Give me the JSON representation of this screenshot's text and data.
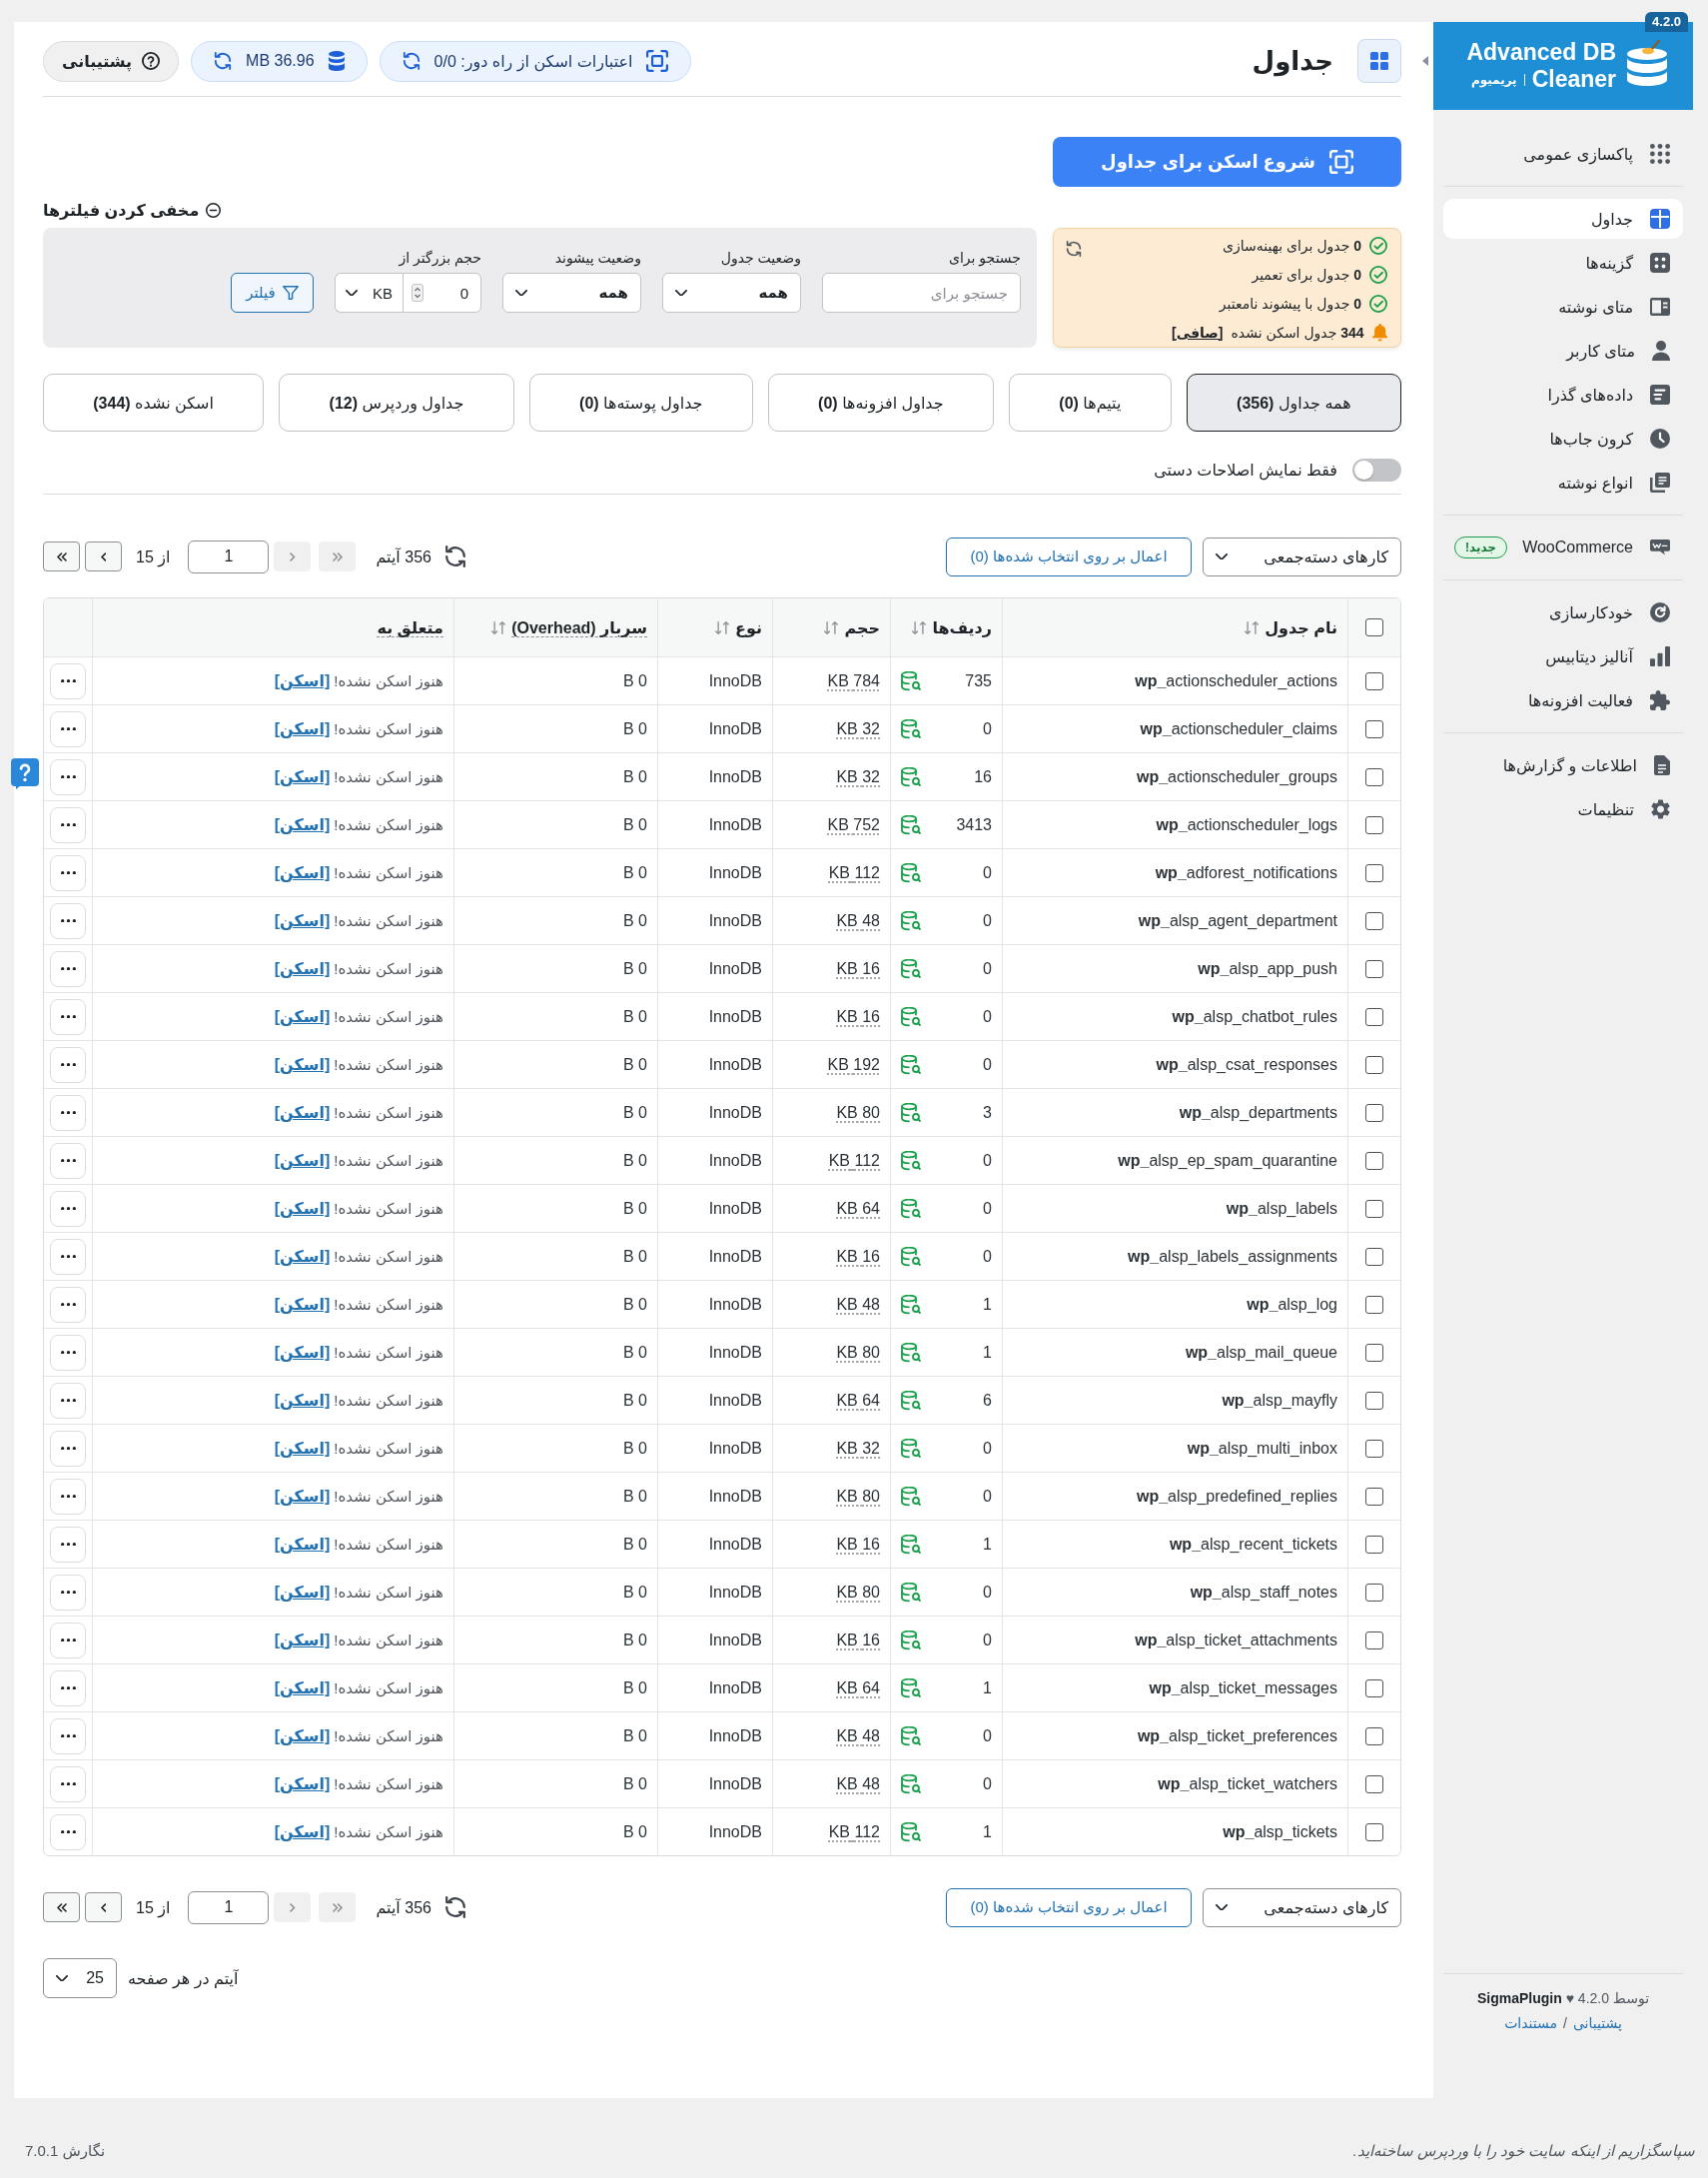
{
  "sidebar": {
    "logo": {
      "title_lines": [
        "Advanced DB",
        "Cleaner"
      ],
      "edition": "پریمیوم",
      "version": "4.2.0"
    },
    "sections": [
      {
        "items": [
          {
            "label": "پاکسازی عمومی",
            "selected": false
          }
        ]
      },
      {
        "items": [
          {
            "label": "جداول",
            "selected": true
          },
          {
            "label": "گزینه‌ها",
            "selected": false
          },
          {
            "label": "متای نوشته",
            "selected": false
          },
          {
            "label": "متای کاربر",
            "selected": false
          },
          {
            "label": "داده‌های گذرا",
            "selected": false
          },
          {
            "label": "کرون جاب‌ها",
            "selected": false
          },
          {
            "label": "انواع نوشته",
            "selected": false
          }
        ]
      },
      {
        "items": [
          {
            "label": "WooCommerce",
            "badge": "جدید!",
            "selected": false
          }
        ]
      },
      {
        "items": [
          {
            "label": "خودکارسازی",
            "selected": false
          },
          {
            "label": "آنالیز دیتابیس",
            "selected": false
          },
          {
            "label": "فعالیت افزونه‌ها",
            "selected": false
          }
        ]
      },
      {
        "items": [
          {
            "label": "اطلاعات و گزارش‌ها",
            "selected": false
          },
          {
            "label": "تنظیمات",
            "selected": false
          }
        ]
      }
    ],
    "footer": {
      "credit": "توسط **SigmaPlugin** ♥ 4.2.0",
      "links": [
        "پشتیبانی",
        "مستندات"
      ],
      "separator": "/"
    }
  },
  "header": {
    "title": "جداول",
    "remote_scan": {
      "label": "اعتبارات اسکن از راه دور:",
      "value": "0/0"
    },
    "db_size": "36.96 MB",
    "support": "پشتیبانی"
  },
  "scan_button": "شروع اسکن برای جداول",
  "filters": {
    "toggle": "مخفی کردن فیلترها",
    "summary": [
      {
        "kind": "ok",
        "count": "0",
        "text": "جدول برای بهینه‌سازی"
      },
      {
        "kind": "ok",
        "count": "0",
        "text": "جدول برای تعمیر"
      },
      {
        "kind": "ok",
        "count": "0",
        "text": "جدول با پیشوند نامعتبر"
      },
      {
        "kind": "warning",
        "count": "344",
        "text": "جدول اسکن نشده",
        "link": "[صافی]"
      }
    ],
    "fields": [
      {
        "kind": "search",
        "label": "جستجو برای",
        "placeholder": "جستجو برای"
      },
      {
        "kind": "select",
        "label": "وضعیت جدول",
        "value": "همه"
      },
      {
        "kind": "select",
        "label": "وضعیت پیشوند",
        "value": "همه"
      },
      {
        "kind": "size",
        "label": "حجم بزرگتر از",
        "value": "0",
        "unit": "KB"
      }
    ],
    "button": "فیلتر"
  },
  "tabs": [
    {
      "label": "همه جداول",
      "count": "(356)",
      "selected": true
    },
    {
      "label": "یتیم‌ها",
      "count": "(0)",
      "selected": false
    },
    {
      "label": "جداول افزونه‌ها",
      "count": "(0)",
      "selected": false
    },
    {
      "label": "جداول پوسته‌ها",
      "count": "(0)",
      "selected": false
    },
    {
      "label": "جداول وردپرس",
      "count": "(12)",
      "selected": false
    },
    {
      "label": "اسکن نشده",
      "count": "(344)",
      "selected": false
    }
  ],
  "manual_toggle": {
    "label": "فقط نمایش اصلاحات دستی",
    "on": false
  },
  "top_toolbar": {
    "bulk_select": "کارهای دسته‌جمعی",
    "apply": "اعمال بر روی انتخاب شده‌ها (0)",
    "count": "356 آیتم",
    "pager": {
      "first": {
        "disabled": true
      },
      "prev": {
        "disabled": true
      },
      "page": "1",
      "total": "از 15",
      "next": {
        "disabled": false
      },
      "last": {
        "disabled": false
      }
    }
  },
  "table": {
    "select_all": {
      "checked": false
    },
    "columns": [
      {
        "label": "نام جدول",
        "sortable": true,
        "hint": false
      },
      {
        "label": "ردیف‌ها",
        "sortable": true,
        "hint": false
      },
      {
        "label": "حجم",
        "sortable": true,
        "hint": false
      },
      {
        "label": "نوع",
        "sortable": true,
        "hint": false
      },
      {
        "label": "سربار (Overhead)",
        "sortable": true,
        "hint": true
      },
      {
        "label": "متعلق به",
        "sortable": false,
        "hint": true
      }
    ],
    "rows": [
      {
        "checked": false,
        "name": "**wp_**actionscheduler_actions",
        "rows": "735",
        "size": "784 KB",
        "type": "InnoDB",
        "overhead": "0 B",
        "status": "هنوز اسکن نشده!",
        "action": "[اسکن]"
      },
      {
        "checked": false,
        "name": "**wp_**actionscheduler_claims",
        "rows": "0",
        "size": "32 KB",
        "type": "InnoDB",
        "overhead": "0 B",
        "status": "هنوز اسکن نشده!",
        "action": "[اسکن]"
      },
      {
        "checked": false,
        "name": "**wp_**actionscheduler_groups",
        "rows": "16",
        "size": "32 KB",
        "type": "InnoDB",
        "overhead": "0 B",
        "status": "هنوز اسکن نشده!",
        "action": "[اسکن]"
      },
      {
        "checked": false,
        "name": "**wp_**actionscheduler_logs",
        "rows": "3413",
        "size": "752 KB",
        "type": "InnoDB",
        "overhead": "0 B",
        "status": "هنوز اسکن نشده!",
        "action": "[اسکن]"
      },
      {
        "checked": false,
        "name": "**wp_**adforest_notifications",
        "rows": "0",
        "size": "112 KB",
        "type": "InnoDB",
        "overhead": "0 B",
        "status": "هنوز اسکن نشده!",
        "action": "[اسکن]"
      },
      {
        "checked": false,
        "name": "**wp_**alsp_agent_department",
        "rows": "0",
        "size": "48 KB",
        "type": "InnoDB",
        "overhead": "0 B",
        "status": "هنوز اسکن نشده!",
        "action": "[اسکن]"
      },
      {
        "checked": false,
        "name": "**wp_**alsp_app_push",
        "rows": "0",
        "size": "16 KB",
        "type": "InnoDB",
        "overhead": "0 B",
        "status": "هنوز اسکن نشده!",
        "action": "[اسکن]"
      },
      {
        "checked": false,
        "name": "**wp_**alsp_chatbot_rules",
        "rows": "0",
        "size": "16 KB",
        "type": "InnoDB",
        "overhead": "0 B",
        "status": "هنوز اسکن نشده!",
        "action": "[اسکن]"
      },
      {
        "checked": false,
        "name": "**wp_**alsp_csat_responses",
        "rows": "0",
        "size": "192 KB",
        "type": "InnoDB",
        "overhead": "0 B",
        "status": "هنوز اسکن نشده!",
        "action": "[اسکن]"
      },
      {
        "checked": false,
        "name": "**wp_**alsp_departments",
        "rows": "3",
        "size": "80 KB",
        "type": "InnoDB",
        "overhead": "0 B",
        "status": "هنوز اسکن نشده!",
        "action": "[اسکن]"
      },
      {
        "checked": false,
        "name": "**wp_**alsp_ep_spam_quarantine",
        "rows": "0",
        "size": "112 KB",
        "type": "InnoDB",
        "overhead": "0 B",
        "status": "هنوز اسکن نشده!",
        "action": "[اسکن]"
      },
      {
        "checked": false,
        "name": "**wp_**alsp_labels",
        "rows": "0",
        "size": "64 KB",
        "type": "InnoDB",
        "overhead": "0 B",
        "status": "هنوز اسکن نشده!",
        "action": "[اسکن]"
      },
      {
        "checked": false,
        "name": "**wp_**alsp_labels_assignments",
        "rows": "0",
        "size": "16 KB",
        "type": "InnoDB",
        "overhead": "0 B",
        "status": "هنوز اسکن نشده!",
        "action": "[اسکن]"
      },
      {
        "checked": false,
        "name": "**wp_**alsp_log",
        "rows": "1",
        "size": "48 KB",
        "type": "InnoDB",
        "overhead": "0 B",
        "status": "هنوز اسکن نشده!",
        "action": "[اسکن]"
      },
      {
        "checked": false,
        "name": "**wp_**alsp_mail_queue",
        "rows": "1",
        "size": "80 KB",
        "type": "InnoDB",
        "overhead": "0 B",
        "status": "هنوز اسکن نشده!",
        "action": "[اسکن]"
      },
      {
        "checked": false,
        "name": "**wp_**alsp_mayfly",
        "rows": "6",
        "size": "64 KB",
        "type": "InnoDB",
        "overhead": "0 B",
        "status": "هنوز اسکن نشده!",
        "action": "[اسکن]"
      },
      {
        "checked": false,
        "name": "**wp_**alsp_multi_inbox",
        "rows": "0",
        "size": "32 KB",
        "type": "InnoDB",
        "overhead": "0 B",
        "status": "هنوز اسکن نشده!",
        "action": "[اسکن]"
      },
      {
        "checked": false,
        "name": "**wp_**alsp_predefined_replies",
        "rows": "0",
        "size": "80 KB",
        "type": "InnoDB",
        "overhead": "0 B",
        "status": "هنوز اسکن نشده!",
        "action": "[اسکن]"
      },
      {
        "checked": false,
        "name": "**wp_**alsp_recent_tickets",
        "rows": "1",
        "size": "16 KB",
        "type": "InnoDB",
        "overhead": "0 B",
        "status": "هنوز اسکن نشده!",
        "action": "[اسکن]"
      },
      {
        "checked": false,
        "name": "**wp_**alsp_staff_notes",
        "rows": "0",
        "size": "80 KB",
        "type": "InnoDB",
        "overhead": "0 B",
        "status": "هنوز اسکن نشده!",
        "action": "[اسکن]"
      },
      {
        "checked": false,
        "name": "**wp_**alsp_ticket_attachments",
        "rows": "0",
        "size": "16 KB",
        "type": "InnoDB",
        "overhead": "0 B",
        "status": "هنوز اسکن نشده!",
        "action": "[اسکن]"
      },
      {
        "checked": false,
        "name": "**wp_**alsp_ticket_messages",
        "rows": "1",
        "size": "64 KB",
        "type": "InnoDB",
        "overhead": "0 B",
        "status": "هنوز اسکن نشده!",
        "action": "[اسکن]"
      },
      {
        "checked": false,
        "name": "**wp_**alsp_ticket_preferences",
        "rows": "0",
        "size": "48 KB",
        "type": "InnoDB",
        "overhead": "0 B",
        "status": "هنوز اسکن نشده!",
        "action": "[اسکن]"
      },
      {
        "checked": false,
        "name": "**wp_**alsp_ticket_watchers",
        "rows": "0",
        "size": "48 KB",
        "type": "InnoDB",
        "overhead": "0 B",
        "status": "هنوز اسکن نشده!",
        "action": "[اسکن]"
      },
      {
        "checked": false,
        "name": "**wp_**alsp_tickets",
        "rows": "1",
        "size": "112 KB",
        "type": "InnoDB",
        "overhead": "0 B",
        "status": "هنوز اسکن نشده!",
        "action": "[اسکن]"
      }
    ]
  },
  "bottom_toolbar": {
    "bulk_select": "کارهای دسته‌جمعی",
    "apply": "اعمال بر روی انتخاب شده‌ها (0)",
    "count": "356 آیتم",
    "pager": {
      "first": {
        "disabled": true
      },
      "prev": {
        "disabled": true
      },
      "page": "1",
      "total": "از 15",
      "next": {
        "disabled": false
      },
      "last": {
        "disabled": false
      }
    }
  },
  "per_page": {
    "label": "آیتم در هر صفحه",
    "value": "25"
  },
  "footer": {
    "thanks": "سپاسگزاریم از اینکه سایت خود را با وردپرس ساخته‌اید.",
    "version": "نگارش 7.0.1"
  }
}
